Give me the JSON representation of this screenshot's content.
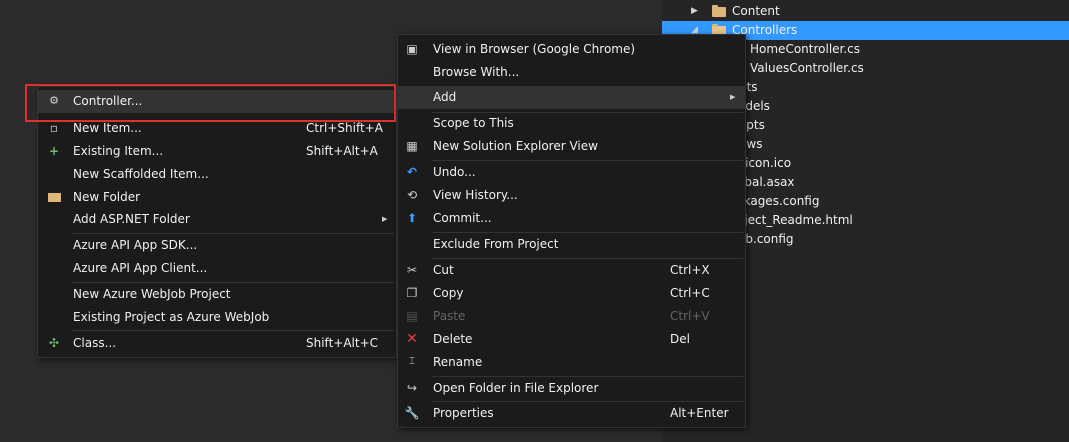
{
  "explorer": {
    "items": [
      {
        "label": "Content",
        "type": "folder"
      },
      {
        "label": "Controllers",
        "type": "folder-open"
      },
      {
        "label": "HomeController.cs",
        "type": "cs"
      },
      {
        "label": "ValuesController.cs",
        "type": "cs"
      },
      {
        "label": "nts",
        "type": "partial"
      },
      {
        "label": "odels",
        "type": "partial"
      },
      {
        "label": "ripts",
        "type": "partial"
      },
      {
        "label": "ews",
        "type": "partial"
      },
      {
        "label": "vicon.ico",
        "type": "partial"
      },
      {
        "label": "obal.asax",
        "type": "partial"
      },
      {
        "label": "ckages.config",
        "type": "partial"
      },
      {
        "label": "oject_Readme.html",
        "type": "partial"
      },
      {
        "label": "eb.config",
        "type": "partial"
      }
    ]
  },
  "add_menu": {
    "items": [
      {
        "label": "Controller...",
        "shortcut": ""
      },
      {
        "label": "New Item...",
        "shortcut": "Ctrl+Shift+A"
      },
      {
        "label": "Existing Item...",
        "shortcut": "Shift+Alt+A"
      },
      {
        "label": "New Scaffolded Item...",
        "shortcut": ""
      },
      {
        "label": "New Folder",
        "shortcut": ""
      },
      {
        "label": "Add ASP.NET Folder",
        "shortcut": ""
      },
      {
        "label": "Azure API App SDK...",
        "shortcut": ""
      },
      {
        "label": "Azure API App Client...",
        "shortcut": ""
      },
      {
        "label": "New Azure WebJob Project",
        "shortcut": ""
      },
      {
        "label": "Existing Project as Azure WebJob",
        "shortcut": ""
      },
      {
        "label": "Class...",
        "shortcut": "Shift+Alt+C"
      }
    ]
  },
  "context_menu": {
    "items": [
      {
        "label": "View in Browser (Google Chrome)",
        "shortcut": ""
      },
      {
        "label": "Browse With...",
        "shortcut": ""
      },
      {
        "label": "Add",
        "shortcut": ""
      },
      {
        "label": "Scope to This",
        "shortcut": ""
      },
      {
        "label": "New Solution Explorer View",
        "shortcut": ""
      },
      {
        "label": "Undo...",
        "shortcut": ""
      },
      {
        "label": "View History...",
        "shortcut": ""
      },
      {
        "label": "Commit...",
        "shortcut": ""
      },
      {
        "label": "Exclude From Project",
        "shortcut": ""
      },
      {
        "label": "Cut",
        "shortcut": "Ctrl+X"
      },
      {
        "label": "Copy",
        "shortcut": "Ctrl+C"
      },
      {
        "label": "Paste",
        "shortcut": "Ctrl+V"
      },
      {
        "label": "Delete",
        "shortcut": "Del"
      },
      {
        "label": "Rename",
        "shortcut": ""
      },
      {
        "label": "Open Folder in File Explorer",
        "shortcut": ""
      },
      {
        "label": "Properties",
        "shortcut": "Alt+Enter"
      }
    ]
  },
  "colors": {
    "selection": "#3399ff",
    "highlight_box": "#e03030",
    "menu_bg": "#1b1b1c"
  }
}
